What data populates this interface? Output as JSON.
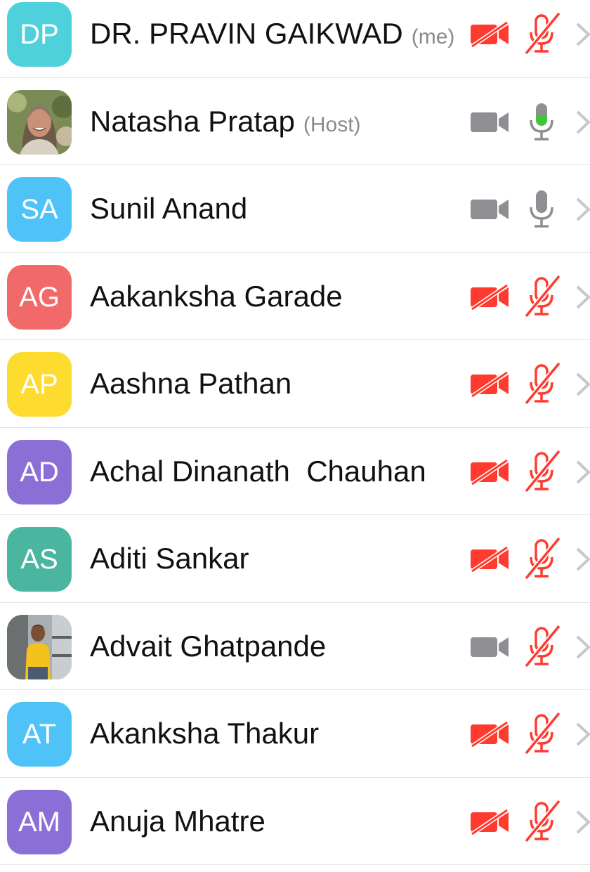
{
  "colors": {
    "muted_red": "#ff3b30",
    "mic_active_green": "#43c43f",
    "icon_gray": "#8e8e93"
  },
  "participants": [
    {
      "initials": "DP",
      "avatar_color": "#4fd1db",
      "name": "DR. PRAVIN GAIKWAD",
      "tag": "(me)",
      "video": "off",
      "audio": "muted"
    },
    {
      "initials": "",
      "avatar_photo": "woman-portrait",
      "name": "Natasha Pratap",
      "tag": "(Host)",
      "video": "on",
      "audio": "speaking"
    },
    {
      "initials": "SA",
      "avatar_color": "#4fc3f7",
      "name": "Sunil Anand",
      "tag": "",
      "video": "on",
      "audio": "unmuted"
    },
    {
      "initials": "AG",
      "avatar_color": "#f2696a",
      "name": "Aakanksha Garade",
      "tag": "",
      "video": "off",
      "audio": "muted"
    },
    {
      "initials": "AP",
      "avatar_color": "#fddb2f",
      "name": "Aashna Pathan",
      "tag": "",
      "video": "off",
      "audio": "muted"
    },
    {
      "initials": "AD",
      "avatar_color": "#8b6fd6",
      "name": "Achal Dinanath  Chauhan",
      "tag": "",
      "video": "off",
      "audio": "muted"
    },
    {
      "initials": "AS",
      "avatar_color": "#4bb6a0",
      "name": "Aditi Sankar",
      "tag": "",
      "video": "off",
      "audio": "muted"
    },
    {
      "initials": "",
      "avatar_photo": "man-yellow-shirt",
      "name": "Advait Ghatpande",
      "tag": "",
      "video": "on",
      "audio": "muted"
    },
    {
      "initials": "AT",
      "avatar_color": "#4fc3f7",
      "name": "Akanksha Thakur",
      "tag": "",
      "video": "off",
      "audio": "muted"
    },
    {
      "initials": "AM",
      "avatar_color": "#8b6fd6",
      "name": "Anuja Mhatre",
      "tag": "",
      "video": "off",
      "audio": "muted"
    }
  ]
}
